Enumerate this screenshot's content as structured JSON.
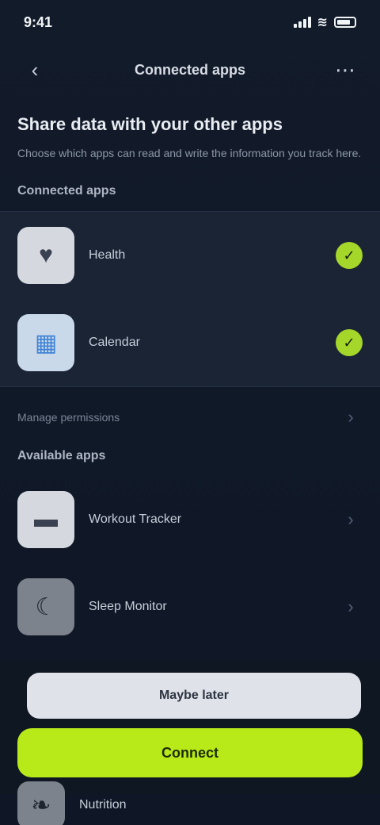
{
  "status_bar": {
    "time": "9:41"
  },
  "nav": {
    "back_icon": "chevron-left-icon",
    "title": "Connected apps",
    "menu_icon": "more-icon"
  },
  "intro": {
    "heading": "Share data with your other apps",
    "description": "Choose which apps can read and write the information you track here."
  },
  "connected": {
    "heading": "Connected apps",
    "items": [
      {
        "name": "Health",
        "status": "connected",
        "icon": "heart-icon"
      },
      {
        "name": "Calendar",
        "status": "connected",
        "icon": "calendar-icon"
      }
    ],
    "manage_label": "Manage permissions"
  },
  "available": {
    "heading": "Available apps",
    "items": [
      {
        "name": "Workout Tracker",
        "icon": "dumbbell-icon"
      },
      {
        "name": "Sleep Monitor",
        "icon": "moon-icon"
      },
      {
        "name": "Nutrition",
        "icon": "leaf-icon"
      }
    ]
  },
  "actions": {
    "secondary_label": "Maybe later",
    "primary_label": "Connect"
  },
  "colors": {
    "accent": "#b8ea1a",
    "status_connected": "#a5d62a",
    "background": "#111a29"
  }
}
